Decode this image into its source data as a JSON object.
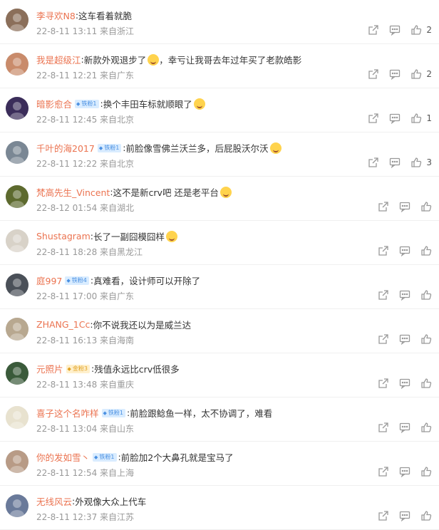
{
  "comments": [
    {
      "user": "李寻欢N8",
      "badge": "",
      "content": "这车看着就脆",
      "emoji": "",
      "time": "22-8-11 13:11 来自浙江",
      "likes": "2",
      "avatar_color": "#8b6f5a"
    },
    {
      "user": "我是超级江",
      "badge": "",
      "content": "新款外观退步了",
      "emoji": "😰",
      "content2": "，幸亏让我哥去年过年买了老款皓影",
      "time": "22-8-11 12:21 来自广东",
      "likes": "2",
      "avatar_color": "#c98b6b"
    },
    {
      "user": "暗影愈合",
      "badge": "铁粉1",
      "content": "换个丰田车标就顺眼了",
      "emoji": "🤖",
      "time": "22-8-11 12:45 来自北京",
      "likes": "1",
      "avatar_color": "#3b2d5a"
    },
    {
      "user": "千叶的海2017",
      "badge": "铁粉1",
      "content": "前脸像雪佛兰沃兰多，后屁股沃尔沃",
      "emoji": "😂",
      "time": "22-8-11 12:22 来自北京",
      "likes": "3",
      "avatar_color": "#7a8794"
    },
    {
      "user": "梵高先生_Vincent",
      "badge": "",
      "content": "这不是新crv吧 还是老平台",
      "emoji": "😮",
      "time": "22-8-12 01:54 来自湖北",
      "likes": "",
      "avatar_color": "#5d6a2e"
    },
    {
      "user": "Shustagram",
      "badge": "",
      "content": "长了一副囧模囧样",
      "emoji": "😂",
      "time": "22-8-11 18:28 来自黑龙江",
      "likes": "",
      "avatar_color": "#d8d2c8"
    },
    {
      "user": "庭997",
      "badge": "铁粉4",
      "content": "真难看，设计师可以开除了",
      "emoji": "",
      "time": "22-8-11 17:00 来自广东",
      "likes": "",
      "avatar_color": "#4a5058"
    },
    {
      "user": "ZHANG_1Cc",
      "badge": "",
      "content": "你不说我还以为是威兰达",
      "emoji": "",
      "time": "22-8-11 16:13 来自海南",
      "likes": "",
      "avatar_color": "#b8a890"
    },
    {
      "user": "元照片",
      "badge": "金粉3",
      "badge_gold": true,
      "content": "残值永远比crv低很多",
      "emoji": "",
      "time": "22-8-11 13:48 来自重庆",
      "likes": "",
      "avatar_color": "#3a5a3a"
    },
    {
      "user": "喜子这个名咋样",
      "badge": "铁粉1",
      "content": "前脸跟鲶鱼一样，太不协调了，难看",
      "emoji": "",
      "time": "22-8-11 13:04 来自山东",
      "likes": "",
      "avatar_color": "#e8e2cf"
    },
    {
      "user": "你的发如雪丶",
      "badge": "铁粉1",
      "content": "前脸加2个大鼻孔就是宝马了",
      "emoji": "",
      "time": "22-8-11 12:54 来自上海",
      "likes": "",
      "avatar_color": "#b89b86"
    },
    {
      "user": "无线风云",
      "badge": "",
      "content": "外观像大众上代车",
      "emoji": "",
      "time": "22-8-11 12:37 来自江苏",
      "likes": "",
      "avatar_color": "#6a7a9a"
    }
  ],
  "icons": {
    "share": "share-icon",
    "comment": "comment-icon",
    "like": "like-icon"
  }
}
